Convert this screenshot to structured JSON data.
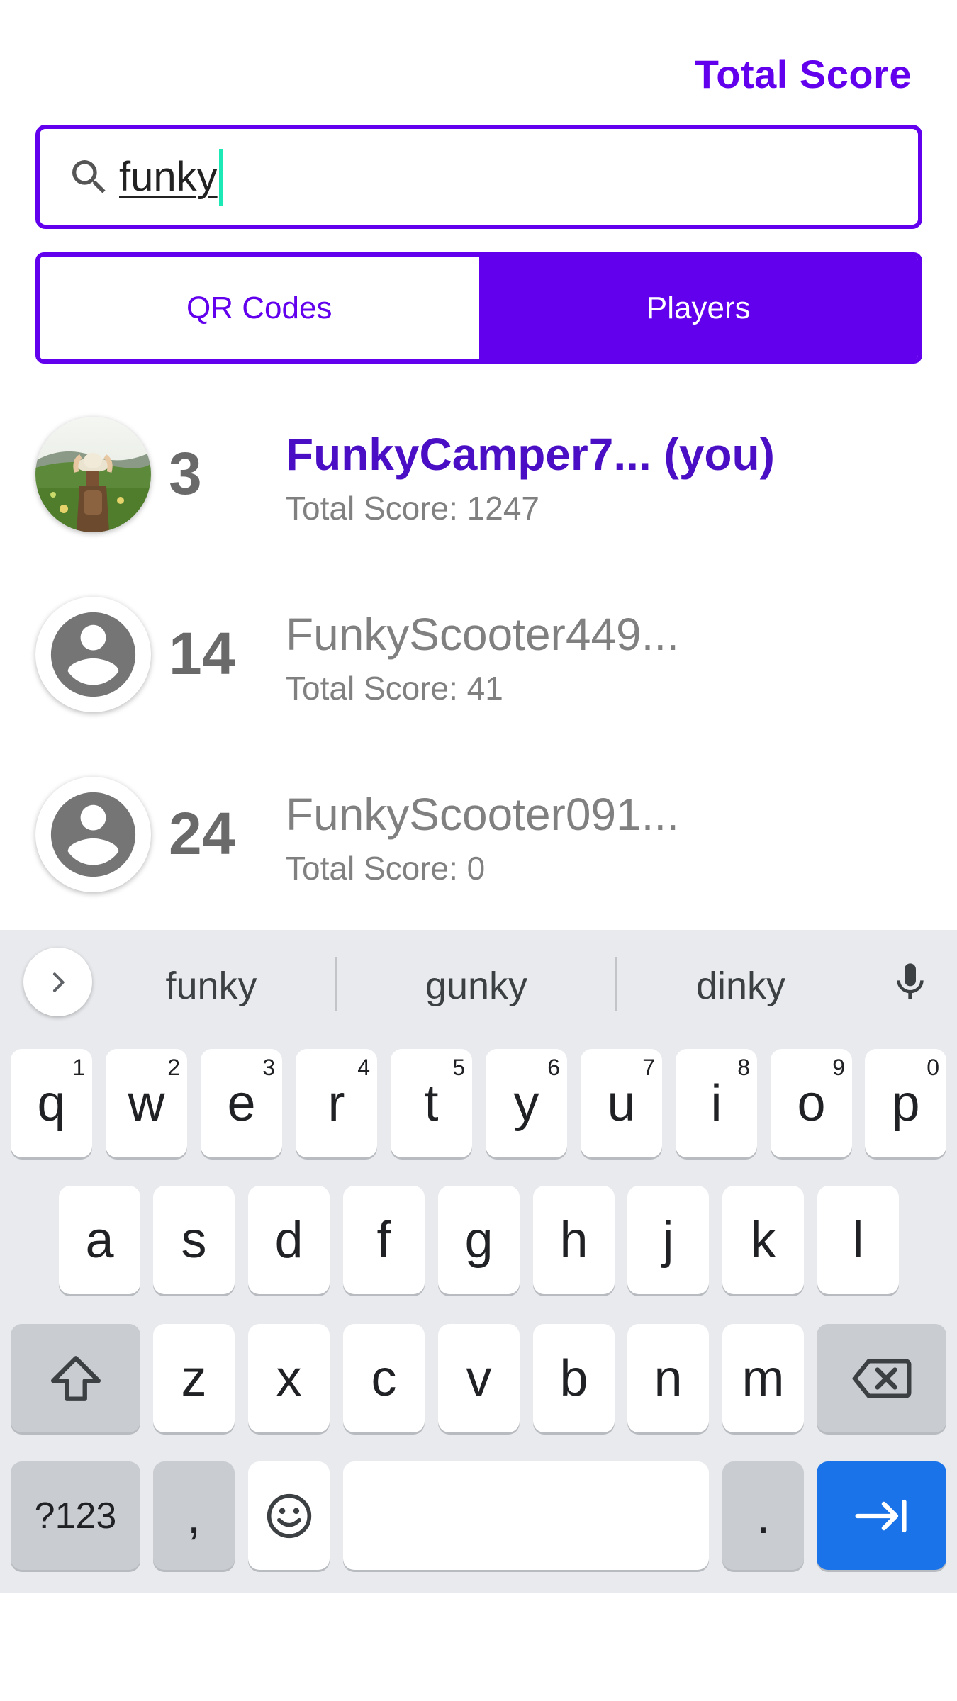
{
  "header": {
    "total_score_label": "Total Score"
  },
  "search": {
    "value": "funky"
  },
  "tabs": [
    {
      "label": "QR Codes",
      "selected": false
    },
    {
      "label": "Players",
      "selected": true
    }
  ],
  "players": [
    {
      "rank": "3",
      "name": "FunkyCamper7... (you)",
      "score": "Total Score: 1247",
      "is_you": true,
      "avatar": "photo"
    },
    {
      "rank": "14",
      "name": "FunkyScooter449...",
      "score": "Total Score: 41",
      "is_you": false,
      "avatar": "default-account-icon"
    },
    {
      "rank": "24",
      "name": "FunkyScooter091...",
      "score": "Total Score: 0",
      "is_you": false,
      "avatar": "default-account-icon"
    }
  ],
  "keyboard": {
    "suggestions": [
      "funky",
      "gunky",
      "dinky"
    ],
    "row1": [
      {
        "k": "q",
        "n": "1"
      },
      {
        "k": "w",
        "n": "2"
      },
      {
        "k": "e",
        "n": "3"
      },
      {
        "k": "r",
        "n": "4"
      },
      {
        "k": "t",
        "n": "5"
      },
      {
        "k": "y",
        "n": "6"
      },
      {
        "k": "u",
        "n": "7"
      },
      {
        "k": "i",
        "n": "8"
      },
      {
        "k": "o",
        "n": "9"
      },
      {
        "k": "p",
        "n": "0"
      }
    ],
    "row2": [
      "a",
      "s",
      "d",
      "f",
      "g",
      "h",
      "j",
      "k",
      "l"
    ],
    "row3": [
      "z",
      "x",
      "c",
      "v",
      "b",
      "n",
      "m"
    ],
    "symbols_label": "?123",
    "comma": ",",
    "period": "."
  },
  "colors": {
    "accent": "#6200ee",
    "you_name": "#4a0fc4",
    "enter_key": "#1a73e8",
    "caret": "#1de9b6"
  }
}
